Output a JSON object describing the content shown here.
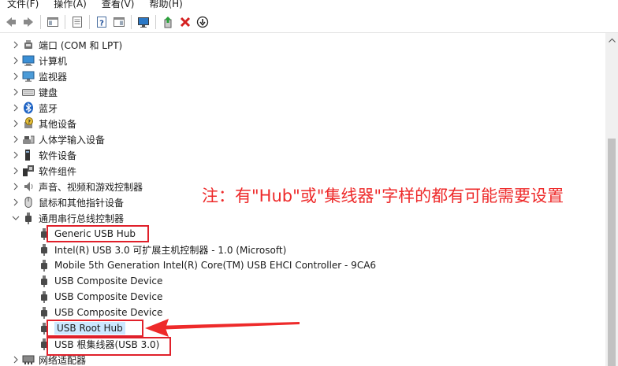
{
  "menubar": [
    "文件(F)",
    "操作(A)",
    "查看(V)",
    "帮助(H)"
  ],
  "toolbar": [
    {
      "name": "back-arrow-icon"
    },
    {
      "name": "forward-arrow-icon"
    },
    {
      "sep": true
    },
    {
      "name": "show-hide-console-tree-icon"
    },
    {
      "sep": true
    },
    {
      "name": "properties-icon"
    },
    {
      "sep": true
    },
    {
      "name": "help-icon"
    },
    {
      "name": "action-pane-icon"
    },
    {
      "sep": true
    },
    {
      "name": "monitor-scan-icon"
    },
    {
      "sep": true
    },
    {
      "name": "update-driver-icon"
    },
    {
      "name": "uninstall-x-icon"
    },
    {
      "name": "download-circle-icon"
    }
  ],
  "tree": [
    {
      "label": "端口 (COM 和 LPT)",
      "icon": "port-icon",
      "level": 1,
      "state": "collapsed"
    },
    {
      "label": "计算机",
      "icon": "computer-icon",
      "level": 1,
      "state": "collapsed"
    },
    {
      "label": "监视器",
      "icon": "monitor-icon",
      "level": 1,
      "state": "collapsed"
    },
    {
      "label": "键盘",
      "icon": "keyboard-icon",
      "level": 1,
      "state": "collapsed"
    },
    {
      "label": "蓝牙",
      "icon": "bluetooth-icon",
      "level": 1,
      "state": "collapsed"
    },
    {
      "label": "其他设备",
      "icon": "unknown-device-icon",
      "level": 1,
      "state": "collapsed"
    },
    {
      "label": "人体学输入设备",
      "icon": "hid-icon",
      "level": 1,
      "state": "collapsed"
    },
    {
      "label": "软件设备",
      "icon": "software-device-icon",
      "level": 1,
      "state": "collapsed"
    },
    {
      "label": "软件组件",
      "icon": "software-component-icon",
      "level": 1,
      "state": "collapsed"
    },
    {
      "label": "声音、视频和游戏控制器",
      "icon": "speaker-icon",
      "level": 1,
      "state": "collapsed"
    },
    {
      "label": "鼠标和其他指针设备",
      "icon": "mouse-icon",
      "level": 1,
      "state": "collapsed"
    },
    {
      "label": "通用串行总线控制器",
      "icon": "usb-icon",
      "level": 1,
      "state": "expanded"
    },
    {
      "label": "Generic USB Hub",
      "icon": "usb-icon",
      "level": 2
    },
    {
      "label": "Intel(R) USB 3.0 可扩展主机控制器 - 1.0 (Microsoft)",
      "icon": "usb-icon",
      "level": 2
    },
    {
      "label": "Mobile 5th Generation Intel(R) Core(TM) USB EHCI Controller - 9CA6",
      "icon": "usb-icon",
      "level": 2
    },
    {
      "label": "USB Composite Device",
      "icon": "usb-icon",
      "level": 2
    },
    {
      "label": "USB Composite Device",
      "icon": "usb-icon",
      "level": 2
    },
    {
      "label": "USB Composite Device",
      "icon": "usb-icon",
      "level": 2
    },
    {
      "label": "USB Root Hub",
      "icon": "usb-icon",
      "level": 2,
      "selected": true
    },
    {
      "label": "USB 根集线器(USB 3.0)",
      "icon": "usb-icon",
      "level": 2
    },
    {
      "label": "网络适配器",
      "icon": "network-adapter-icon",
      "level": 1,
      "state": "collapsed"
    }
  ],
  "annotation": {
    "note": "注：有\"Hub\"或\"集线器\"字样的都有可能需要设置",
    "color": "#ee2a2a"
  },
  "colors": {
    "selection": "#cce8ff",
    "highlight_box": "#e0202a"
  }
}
